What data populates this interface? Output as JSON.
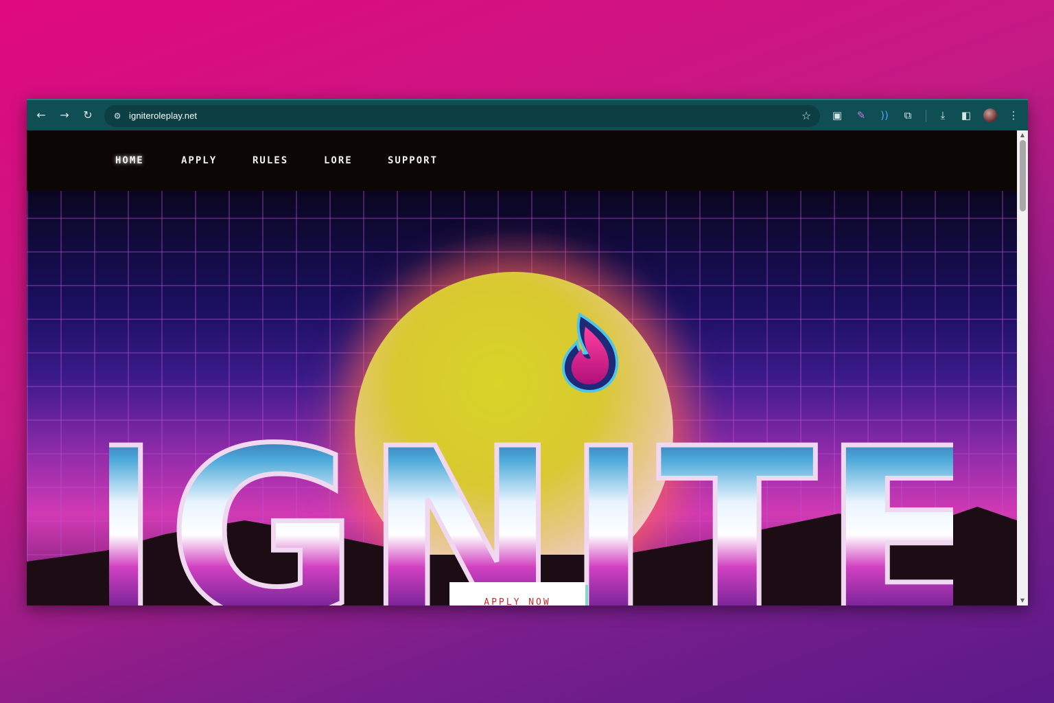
{
  "browser": {
    "url": "igniteroleplay.net",
    "nav_buttons": {
      "back": "arrow-left-icon",
      "forward": "arrow-right-icon",
      "reload": "reload-icon"
    },
    "extensions": [
      "window-icon",
      "feather-icon",
      "broadcast-icon",
      "puzzle-icon"
    ],
    "toolbar_icons": [
      "download-icon",
      "sidepanel-icon",
      "avatar",
      "kebab-menu-icon"
    ],
    "colors": {
      "toolbar": "#0f4f53",
      "omnibox": "#0b3f43"
    }
  },
  "site": {
    "nav": [
      {
        "label": "HOME",
        "active": true
      },
      {
        "label": "APPLY",
        "active": false
      },
      {
        "label": "RULES",
        "active": false
      },
      {
        "label": "LORE",
        "active": false
      },
      {
        "label": "SUPPORT",
        "active": false
      }
    ],
    "hero": {
      "logo_text": "IGNITE",
      "cta": "APPLY NOW",
      "colors": {
        "cta_text": "#c62828",
        "nav_bg": "#0c0605"
      }
    }
  },
  "page": {
    "background_gradient": [
      "#e0097f",
      "#5c1a8a"
    ]
  }
}
